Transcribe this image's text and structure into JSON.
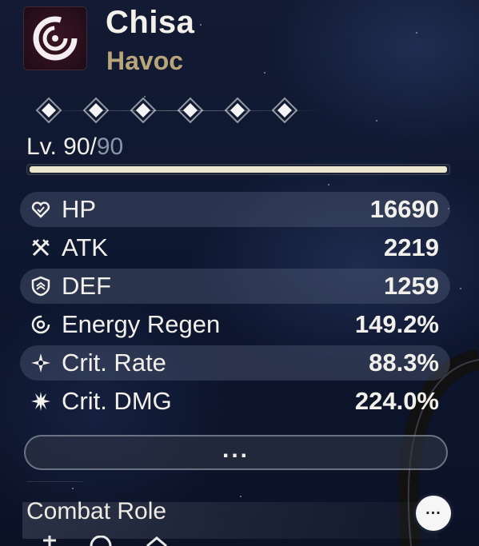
{
  "character": {
    "name": "Chisa",
    "element": "Havoc",
    "avatar_icon": "havoc-element-icon"
  },
  "resonance_chain": {
    "nodes_count": 6,
    "unlocked": 6,
    "node_icon": "diamond-node-icon"
  },
  "level": {
    "current": "Lv. 90/",
    "max": "90",
    "progress_fraction": 1.0
  },
  "stats": [
    {
      "label": "HP",
      "value": "16690",
      "icon": "heart-icon"
    },
    {
      "label": "ATK",
      "value": "2219",
      "icon": "crossed-swords-icon"
    },
    {
      "label": "DEF",
      "value": "1259",
      "icon": "shield-icon"
    },
    {
      "label": "Energy Regen",
      "value": "149.2%",
      "icon": "energy-regen-icon"
    },
    {
      "label": "Crit. Rate",
      "value": "88.3%",
      "icon": "crit-rate-sparkle-icon"
    },
    {
      "label": "Crit. DMG",
      "value": "224.0%",
      "icon": "crit-dmg-burst-icon"
    }
  ],
  "more_button": {
    "label": "..."
  },
  "combat_role": {
    "title": "Combat Role"
  },
  "fab": {
    "label": "..."
  },
  "colors": {
    "element_gold": "#b9a57a",
    "text_main": "#f2f0ea",
    "level_fill": "#ece6cf"
  }
}
